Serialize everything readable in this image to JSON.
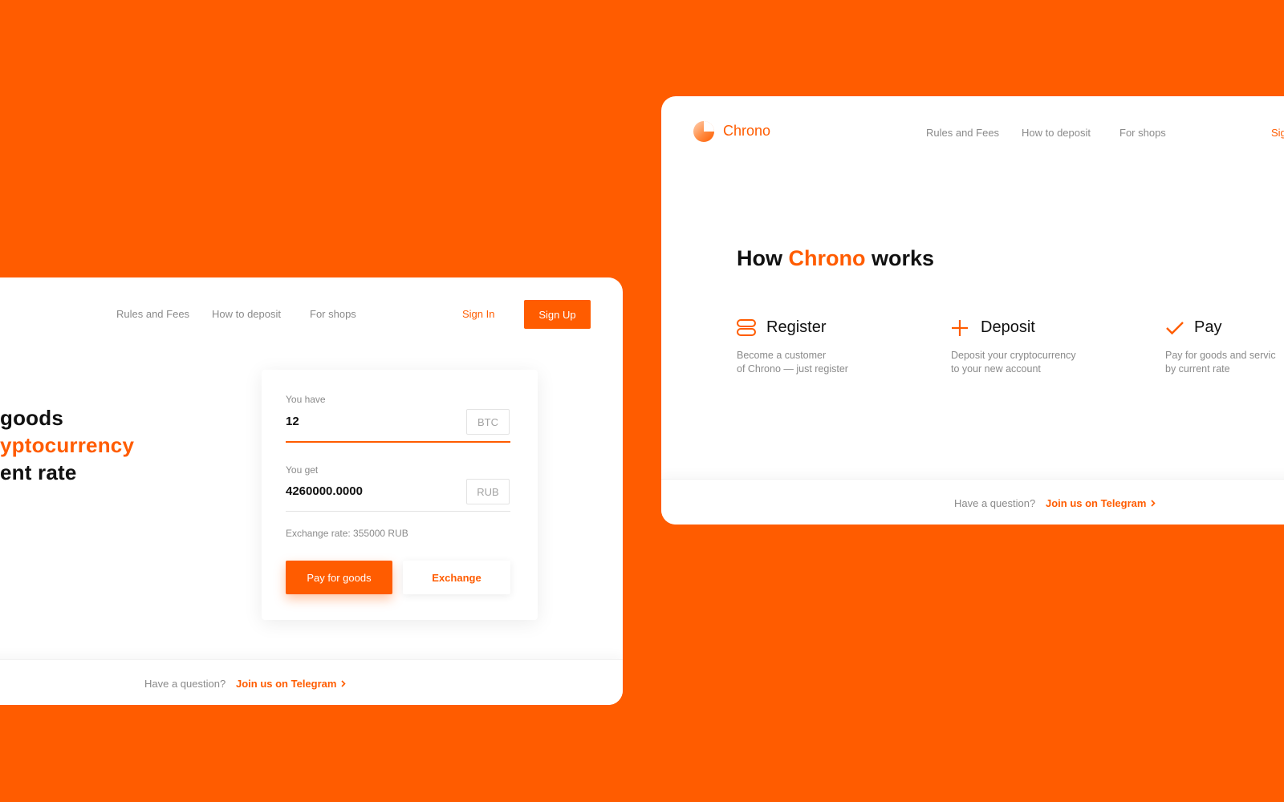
{
  "left_card": {
    "nav": {
      "links": [
        "Rules and Fees",
        "How to deposit",
        "For shops"
      ],
      "sign_in": "Sign In",
      "sign_up": "Sign Up"
    },
    "hero": {
      "line1": "goods",
      "line2": "yptocurrency",
      "line3": "ent rate"
    },
    "exchange_panel": {
      "have_label": "You have",
      "have_value": "12",
      "have_currency": "BTC",
      "get_label": "You get",
      "get_value": "4260000.0000",
      "get_currency": "RUB",
      "rate": "Exchange rate: 355000 RUB",
      "pay_button": "Pay for goods",
      "exchange_button": "Exchange"
    },
    "footer": {
      "question": "Have a question?",
      "link": "Join us on Telegram"
    }
  },
  "right_card": {
    "logo": "Chrono",
    "nav": {
      "links": [
        "Rules and Fees",
        "How to deposit",
        "For shops"
      ],
      "sign_in_partial": "Sig"
    },
    "section": {
      "title_prefix": "How",
      "title_brand": "Chrono",
      "title_suffix": "works"
    },
    "steps": [
      {
        "icon": "register-icon",
        "title": "Register",
        "desc_line1": "Become a customer",
        "desc_line2": "of Chrono — just register"
      },
      {
        "icon": "plus-icon",
        "title": "Deposit",
        "desc_line1": "Deposit your cryptocurrency",
        "desc_line2": "to your new account"
      },
      {
        "icon": "check-icon",
        "title": "Pay",
        "desc_line1": "Pay for goods and servic",
        "desc_line2": "by current rate"
      }
    ],
    "footer": {
      "question": "Have a question?",
      "link": "Join us on Telegram"
    }
  },
  "colors": {
    "accent": "#FF5C00",
    "background": "#FF5C00",
    "muted_text": "#8a8a8a"
  }
}
